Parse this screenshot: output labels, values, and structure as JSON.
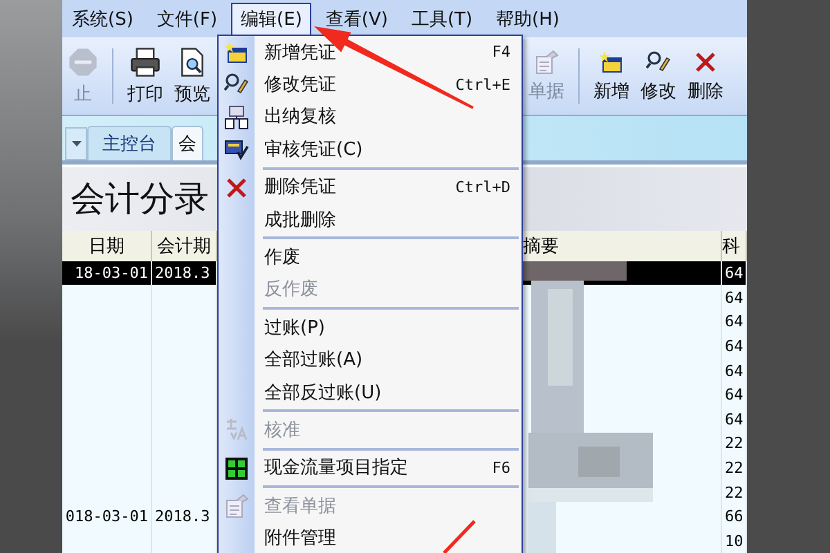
{
  "menu_bar": [
    {
      "label": "系统(S)",
      "selected": false
    },
    {
      "label": "文件(F)",
      "selected": false
    },
    {
      "label": "编辑(E)",
      "selected": true
    },
    {
      "label": "查看(V)",
      "selected": false
    },
    {
      "label": "工具(T)",
      "selected": false
    },
    {
      "label": "帮助(H)",
      "selected": false
    }
  ],
  "toolbar": [
    {
      "label": "止",
      "disabled": true
    },
    {
      "label": "打印",
      "disabled": false
    },
    {
      "label": "预览",
      "disabled": false
    },
    {
      "label": "单据",
      "disabled": true
    },
    {
      "label": "新增",
      "disabled": false
    },
    {
      "label": "修改",
      "disabled": false
    },
    {
      "label": "删除",
      "disabled": false
    }
  ],
  "tabs": [
    {
      "label": "主控台",
      "selected": false
    },
    {
      "label": "会",
      "selected": true
    }
  ],
  "page_title": "会计分录",
  "table": {
    "columns": [
      "日期",
      "会计期",
      "摘要",
      "科"
    ],
    "rows": [
      {
        "date": "18-03-01",
        "period": "2018.3",
        "account": "64",
        "selected": true
      },
      {
        "account": "64",
        "selected": false
      },
      {
        "account": "64",
        "selected": false
      },
      {
        "account": "64",
        "selected": false
      },
      {
        "account": "64",
        "selected": false
      },
      {
        "account": "64",
        "selected": false
      },
      {
        "account": "64",
        "selected": false
      },
      {
        "account": "22",
        "selected": false
      },
      {
        "account": "22",
        "selected": false
      },
      {
        "account": "22",
        "selected": false
      },
      {
        "date": "018-03-01",
        "period": "2018.3",
        "account": "66",
        "selected": false
      },
      {
        "account": "10",
        "selected": false
      }
    ]
  },
  "edit_menu": {
    "items": [
      {
        "kind": "item",
        "label": "新增凭证",
        "shortcut": "F4",
        "disabled": false
      },
      {
        "kind": "item",
        "label": "修改凭证",
        "shortcut": "Ctrl+E",
        "disabled": false
      },
      {
        "kind": "item",
        "label": "出纳复核",
        "disabled": false
      },
      {
        "kind": "item",
        "label": "审核凭证(C)",
        "disabled": false
      },
      {
        "kind": "separator"
      },
      {
        "kind": "item",
        "label": "删除凭证",
        "shortcut": "Ctrl+D",
        "disabled": false
      },
      {
        "kind": "item",
        "label": "成批删除",
        "disabled": false
      },
      {
        "kind": "separator"
      },
      {
        "kind": "item",
        "label": "作废",
        "disabled": false
      },
      {
        "kind": "item",
        "label": "反作废",
        "disabled": true
      },
      {
        "kind": "separator"
      },
      {
        "kind": "item",
        "label": "过账(P)",
        "disabled": false
      },
      {
        "kind": "item",
        "label": "全部过账(A)",
        "disabled": false
      },
      {
        "kind": "item",
        "label": "全部反过账(U)",
        "disabled": false
      },
      {
        "kind": "separator"
      },
      {
        "kind": "item",
        "label": "核准",
        "disabled": true
      },
      {
        "kind": "separator"
      },
      {
        "kind": "item",
        "label": "现金流量项目指定",
        "shortcut": "F6",
        "disabled": false
      },
      {
        "kind": "separator"
      },
      {
        "kind": "item",
        "label": "查看单据",
        "disabled": true
      },
      {
        "kind": "item",
        "label": "附件管理",
        "disabled": false
      }
    ]
  }
}
